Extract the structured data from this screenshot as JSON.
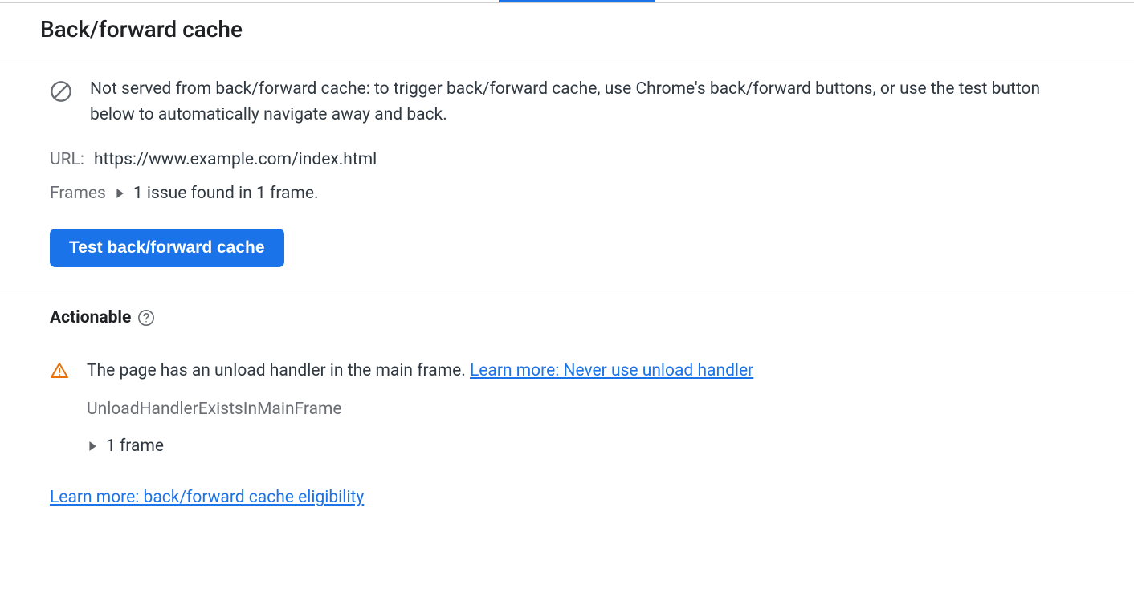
{
  "header": {
    "title": "Back/forward cache"
  },
  "status": {
    "message": "Not served from back/forward cache: to trigger back/forward cache, use Chrome's back/forward buttons, or use the test button below to automatically navigate away and back."
  },
  "url": {
    "label": "URL:",
    "value": "https://www.example.com/index.html"
  },
  "frames": {
    "label": "Frames",
    "summary": "1 issue found in 1 frame."
  },
  "button": {
    "test_label": "Test back/forward cache"
  },
  "actionable": {
    "title": "Actionable",
    "issue": {
      "message": "The page has an unload handler in the main frame. ",
      "learn_more_label": "Learn more: Never use unload handler",
      "reason_code": "UnloadHandlerExistsInMainFrame",
      "frame_count": "1 frame"
    }
  },
  "footer": {
    "learn_more_label": "Learn more: back/forward cache eligibility"
  }
}
